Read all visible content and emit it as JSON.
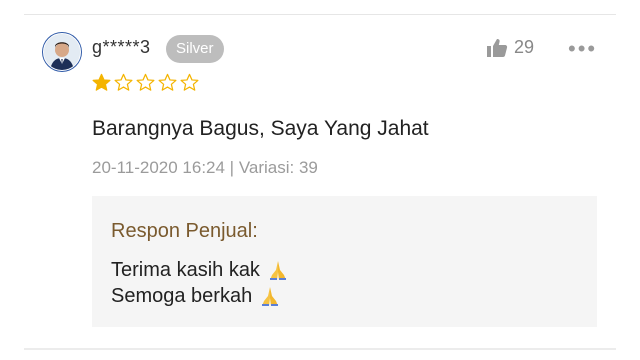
{
  "review": {
    "username": "g*****3",
    "badge": "Silver",
    "likes": "29",
    "more_label": "•••",
    "rating": 1,
    "rating_max": 5,
    "star_color": "#f4b400",
    "text": "Barangnya Bagus, Saya Yang Jahat",
    "meta": "20-11-2020 16:24 | Variasi: 39"
  },
  "seller_reply": {
    "title": "Respon Penjual:",
    "lines": [
      "Terima kasih kak",
      "Semoga berkah"
    ],
    "icon": "folded-hands-icon"
  }
}
